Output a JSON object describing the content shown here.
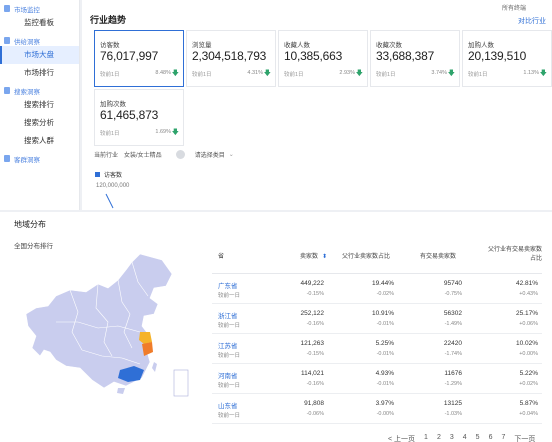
{
  "sidebar": {
    "groups": [
      {
        "label": "市场监控",
        "items": [
          {
            "label": "监控看板",
            "active": false
          }
        ]
      },
      {
        "label": "供给洞察",
        "items": [
          {
            "label": "市场大盘",
            "active": true
          },
          {
            "label": "市场排行",
            "active": false
          }
        ]
      },
      {
        "label": "搜索洞察",
        "items": [
          {
            "label": "搜索排行",
            "active": false
          },
          {
            "label": "搜索分析",
            "active": false
          },
          {
            "label": "搜索人群",
            "active": false
          }
        ]
      },
      {
        "label": "客群洞察",
        "items": []
      }
    ]
  },
  "main": {
    "title": "行业趋势",
    "top_right_1": "所有终端",
    "top_right_2": "对比行业",
    "cards": [
      {
        "label": "访客数",
        "value": "76,017,997",
        "compare": "较前1日",
        "pct": "8.48%",
        "dir": "down",
        "selected": true
      },
      {
        "label": "浏览量",
        "value": "2,304,518,793",
        "compare": "较前1日",
        "pct": "4.31%",
        "dir": "down",
        "selected": false
      },
      {
        "label": "收藏人数",
        "value": "10,385,663",
        "compare": "较前1日",
        "pct": "2.93%",
        "dir": "down",
        "selected": false
      },
      {
        "label": "收藏次数",
        "value": "33,688,387",
        "compare": "较前1日",
        "pct": "3.74%",
        "dir": "down",
        "selected": false
      },
      {
        "label": "加购人数",
        "value": "20,139,510",
        "compare": "较前1日",
        "pct": "1.13%",
        "dir": "down",
        "selected": false
      },
      {
        "label": "加购次数",
        "value": "61,465,873",
        "compare": "较前1日",
        "pct": "1.69%",
        "dir": "down",
        "selected": false
      }
    ],
    "filter": {
      "label": "当前行业",
      "value": "女装/女士精品",
      "select_placeholder": "请选择类目"
    },
    "legend": "访客数",
    "axis_value": "120,000,000"
  },
  "region": {
    "title": "地域分布",
    "subtitle": "全国分布排行",
    "headers": [
      "省",
      "卖家数",
      "父行业卖家数占比",
      "有交易卖家数",
      "父行业有交易卖家数占比"
    ],
    "rows": [
      {
        "province": "广东省",
        "sellers": "449,222",
        "sellers_chg": "-0.15%",
        "share": "19.44%",
        "share_chg": "-0.02%",
        "traded": "95740",
        "traded_chg": "-0.75%",
        "traded_share": "42.81%",
        "traded_share_chg": "+0.43%",
        "compare": "较前一日"
      },
      {
        "province": "浙江省",
        "sellers": "252,122",
        "sellers_chg": "-0.16%",
        "share": "10.91%",
        "share_chg": "-0.01%",
        "traded": "56302",
        "traded_chg": "-1.49%",
        "traded_share": "25.17%",
        "traded_share_chg": "+0.06%",
        "compare": "较前一日"
      },
      {
        "province": "江苏省",
        "sellers": "121,263",
        "sellers_chg": "-0.15%",
        "share": "5.25%",
        "share_chg": "-0.01%",
        "traded": "22420",
        "traded_chg": "-1.74%",
        "traded_share": "10.02%",
        "traded_share_chg": "+0.00%",
        "compare": "较前一日"
      },
      {
        "province": "河南省",
        "sellers": "114,021",
        "sellers_chg": "-0.16%",
        "share": "4.93%",
        "share_chg": "-0.01%",
        "traded": "11676",
        "traded_chg": "-1.29%",
        "traded_share": "5.22%",
        "traded_share_chg": "+0.02%",
        "compare": "较前一日"
      },
      {
        "province": "山东省",
        "sellers": "91,808",
        "sellers_chg": "-0.06%",
        "share": "3.97%",
        "share_chg": "-0.00%",
        "traded": "13125",
        "traded_chg": "-1.03%",
        "traded_share": "5.87%",
        "traded_share_chg": "+0.04%",
        "compare": "较前一日"
      }
    ],
    "pager": [
      "< 上一页",
      "1",
      "2",
      "3",
      "4",
      "5",
      "6",
      "7",
      "下一页"
    ]
  },
  "colors": {
    "accent": "#2f6fd6",
    "down": "#2ea36b",
    "up": "#e4393c",
    "map_base": "#c9cdee",
    "map_guangdong": "#2f6fd6",
    "map_zhejiang": "#f07c2a",
    "map_jiangsu": "#f5b32a"
  }
}
